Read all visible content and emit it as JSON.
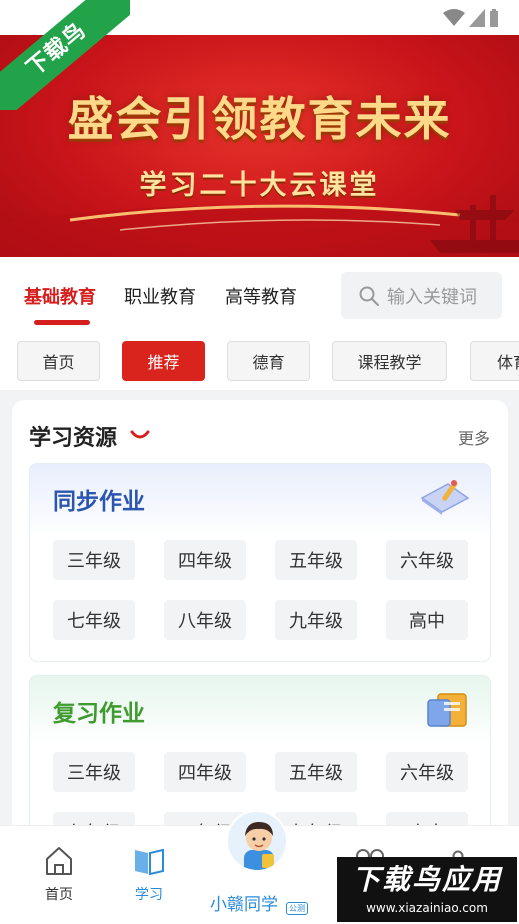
{
  "watermark": {
    "corner_text": "下载鸟",
    "bottom_main": "下载鸟应用",
    "bottom_url": "www.xiazainiao.com"
  },
  "banner": {
    "title": "盛会引领教育未来",
    "subtitle": "学习二十大云课堂"
  },
  "category_tabs": [
    {
      "label": "基础教育",
      "active": true
    },
    {
      "label": "职业教育",
      "active": false
    },
    {
      "label": "高等教育",
      "active": false
    }
  ],
  "search": {
    "placeholder": "输入关键词",
    "icon": "search-icon"
  },
  "chips": [
    {
      "label": "首页",
      "active": false
    },
    {
      "label": "推荐",
      "active": true
    },
    {
      "label": "德育",
      "active": false
    },
    {
      "label": "课程教学",
      "active": false
    },
    {
      "label": "体育",
      "active": false
    }
  ],
  "resources": {
    "title": "学习资源",
    "more_label": "更多",
    "sync": {
      "title": "同步作业",
      "icon": "notebook-pencil-icon",
      "grades": [
        "三年级",
        "四年级",
        "五年级",
        "六年级",
        "七年级",
        "八年级",
        "九年级",
        "高中"
      ]
    },
    "review": {
      "title": "复习作业",
      "icon": "books-icon",
      "grades": [
        "三年级",
        "四年级",
        "五年级",
        "六年级",
        "七年级",
        "八年级",
        "九年级",
        "高中"
      ]
    }
  },
  "bottom_nav": {
    "items": [
      {
        "label": "首页",
        "icon": "home-icon",
        "active": false
      },
      {
        "label": "学习",
        "icon": "book-icon",
        "active": true
      }
    ],
    "center": {
      "label": "小赣同学",
      "badge": "公测"
    }
  },
  "colors": {
    "brand_red": "#d51f1f",
    "sync_blue": "#2c55b0",
    "review_green": "#3f9b2f",
    "nav_blue": "#2a8bd8"
  }
}
